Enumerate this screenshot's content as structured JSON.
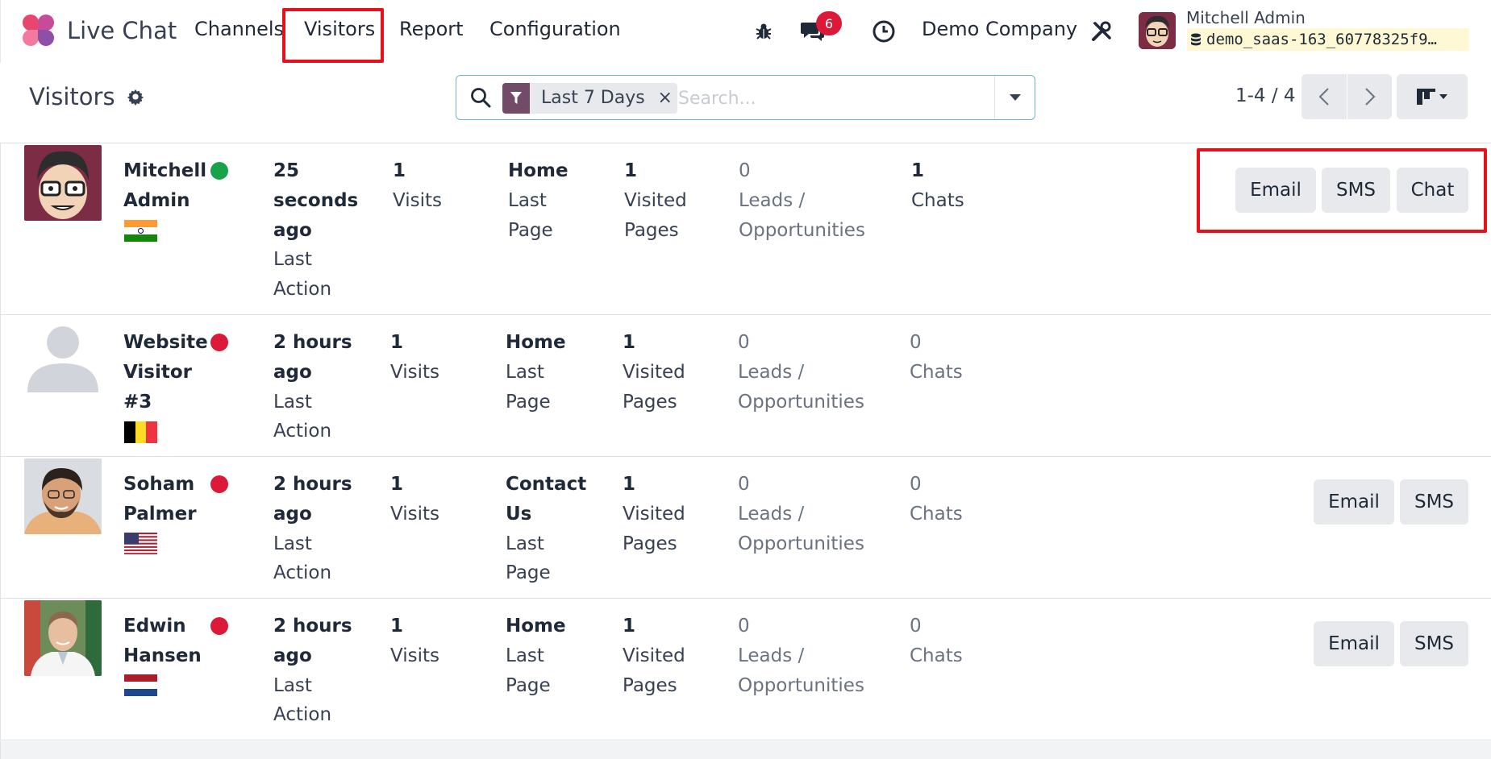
{
  "app": {
    "name": "Live Chat"
  },
  "nav": {
    "items": [
      "Channels",
      "Visitors",
      "Report",
      "Configuration"
    ],
    "active": "Visitors",
    "messages_badge": "6",
    "company": "Demo Company",
    "user_name": "Mitchell Admin",
    "database": "demo_saas-163_60778325f9…"
  },
  "control_panel": {
    "title": "Visitors",
    "search": {
      "facet": "Last 7 Days",
      "placeholder": "Search..."
    },
    "pager": "1-4 / 4"
  },
  "visitors": [
    {
      "name": [
        "Mitchell",
        "Admin"
      ],
      "online": true,
      "country_flag": "india-flag",
      "last_action": [
        "25",
        "seconds",
        "ago"
      ],
      "visits": "1",
      "last_page": [
        "Home"
      ],
      "visited_pages": "1",
      "leads": "0",
      "chats": "1",
      "actions": [
        "Email",
        "SMS",
        "Chat"
      ]
    },
    {
      "name": [
        "Website",
        "Visitor",
        "#3"
      ],
      "online": false,
      "country_flag": "belgium-flag",
      "last_action": [
        "2 hours",
        "ago"
      ],
      "visits": "1",
      "last_page": [
        "Home"
      ],
      "visited_pages": "1",
      "leads": "0",
      "chats": "0",
      "actions": []
    },
    {
      "name": [
        "Soham",
        "Palmer"
      ],
      "online": false,
      "country_flag": "usa-flag",
      "last_action": [
        "2 hours",
        "ago"
      ],
      "visits": "1",
      "last_page": [
        "Contact",
        "Us"
      ],
      "visited_pages": "1",
      "leads": "0",
      "chats": "0",
      "actions": [
        "Email",
        "SMS"
      ]
    },
    {
      "name": [
        "Edwin",
        "Hansen"
      ],
      "online": false,
      "country_flag": "netherlands-flag",
      "last_action": [
        "2 hours",
        "ago"
      ],
      "visits": "1",
      "last_page": [
        "Home"
      ],
      "visited_pages": "1",
      "leads": "0",
      "chats": "0",
      "actions": [
        "Email",
        "SMS"
      ]
    }
  ],
  "labels": {
    "last_action": "Last",
    "action": "Action",
    "visits": "Visits",
    "last": "Last",
    "page": "Page",
    "visited": "Visited",
    "pages": "Pages",
    "leads1": "Leads /",
    "leads2": "Opportunities",
    "chats": "Chats"
  },
  "colors": {
    "online": "#16a34a",
    "offline": "#dc1938",
    "highlight": "#e8111b",
    "brand": "#714b67"
  }
}
